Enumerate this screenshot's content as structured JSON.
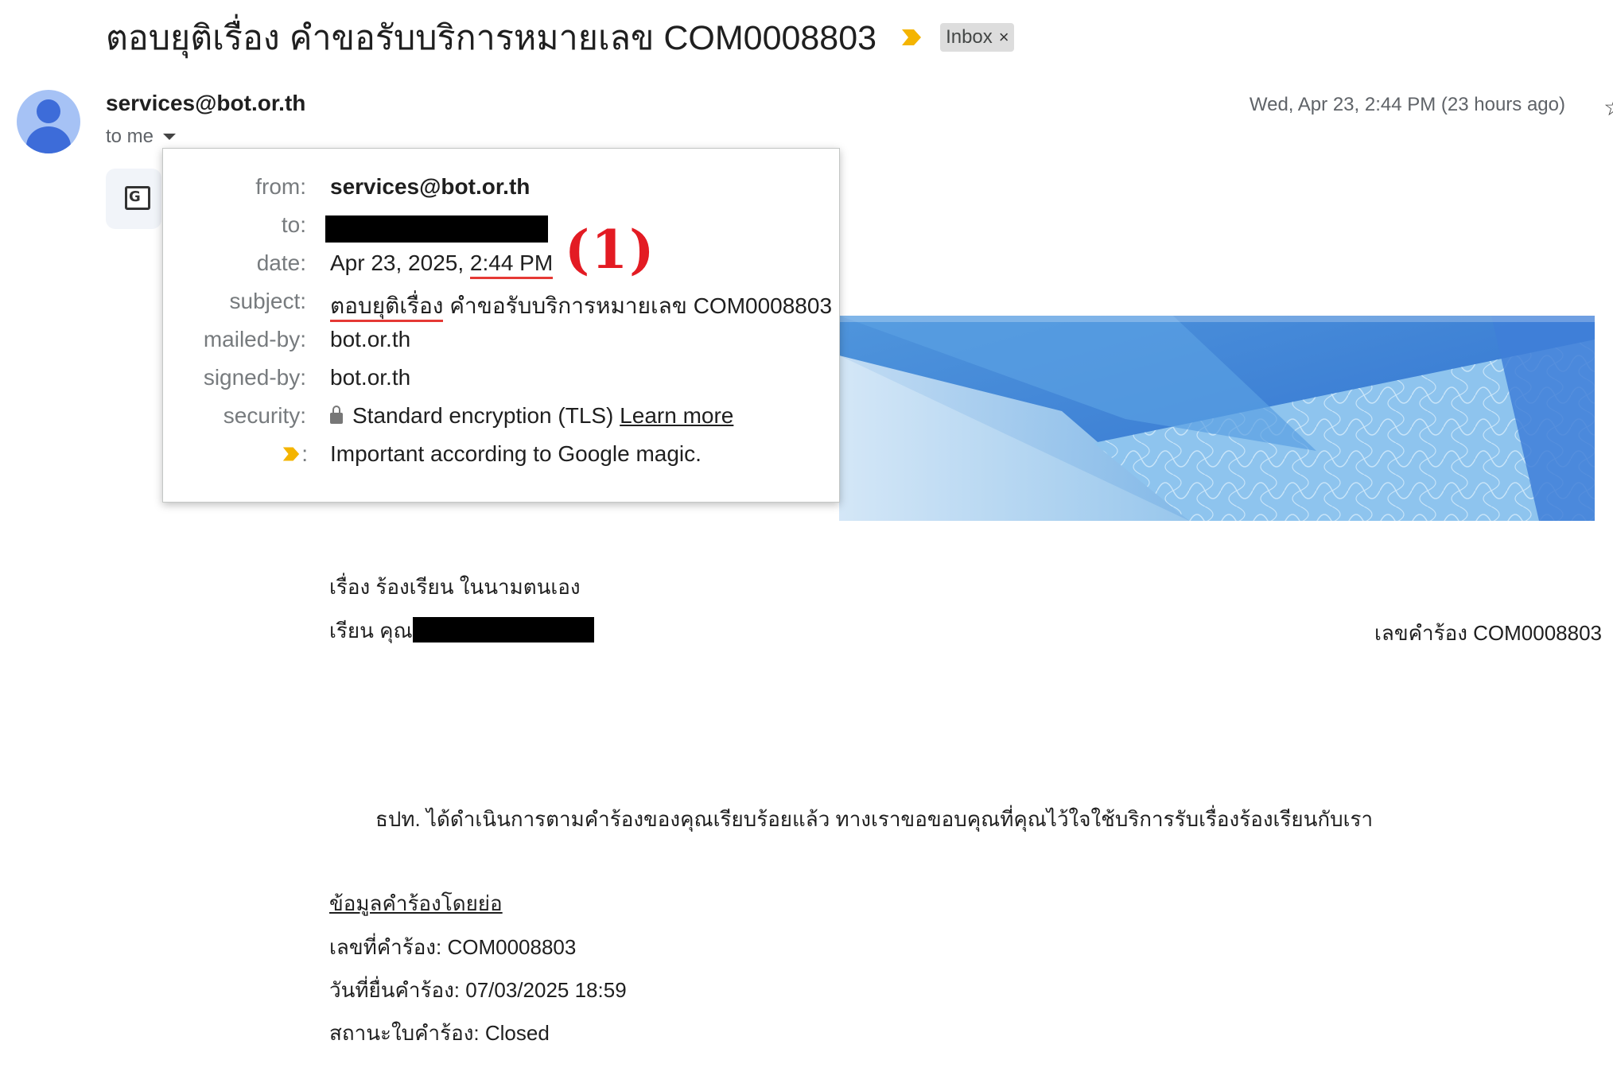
{
  "subject": {
    "text": "ตอบยุติเรื่อง คำขอรับบริการหมายเลข COM0008803",
    "label_chip": "Inbox",
    "label_chip_close": "×"
  },
  "sender": {
    "email": "services@bot.or.th",
    "to_line": "to me",
    "date": "Wed, Apr 23, 2:44 PM (23 hours ago)"
  },
  "details": {
    "from_label": "from:",
    "from_value": "services@bot.or.th",
    "to_label": "to:",
    "date_label": "date:",
    "date_value_prefix": "Apr 23, 2025,",
    "date_value_time": "2:44 PM",
    "subject_label": "subject:",
    "subject_value_part1": "ตอบยุติเรื่อง",
    "subject_value_part2": "คำขอรับบริการหมายเลข COM0008803",
    "mailed_by_label": "mailed-by:",
    "mailed_by_value": "bot.or.th",
    "signed_by_label": "signed-by:",
    "signed_by_value": "bot.or.th",
    "security_label": "security:",
    "security_value": "Standard encryption (TLS)",
    "learn_more": "Learn more",
    "importance_label": ":",
    "importance_value": "Important according to Google magic."
  },
  "annotation": "(1)",
  "body": {
    "topic": "เรื่อง ร้องเรียน ในนามตนเอง",
    "salutation": "เรียน คุณ",
    "ref_number": "เลขคำร้อง COM0008803",
    "paragraph": "ธปท. ได้ดำเนินการตามคำร้องของคุณเรียบร้อยแล้ว ทางเราขอขอบคุณที่คุณไว้ใจใช้บริการรับเรื่องร้องเรียนกับเรา",
    "summary_heading": "ข้อมูลคำร้องโดยย่อ",
    "request_no": "เลขที่คำร้อง: COM0008803",
    "submit_date": "วันที่ยื่นคำร้อง: 07/03/2025 18:59",
    "status": "สถานะใบคำร้อง: Closed"
  },
  "colors": {
    "importance_marker": "#f4b400",
    "annotation_red": "#e31b23",
    "banner_blue": "#3a7bd5"
  },
  "icons": {
    "importance": "importance-marker-icon",
    "avatar": "default-avatar-icon",
    "translate": "translate-icon",
    "lock": "lock-icon",
    "star": "star-icon"
  }
}
